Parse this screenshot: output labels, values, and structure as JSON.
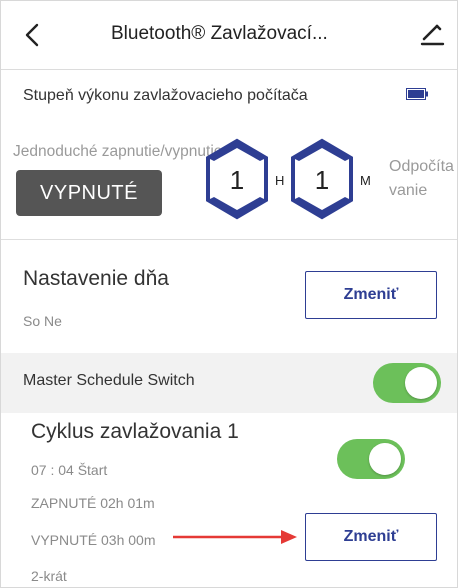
{
  "header": {
    "title": "Bluetooth® Zavlažovací...",
    "back_icon": "chevron-left-icon",
    "edit_icon": "pencil-icon"
  },
  "power": {
    "label": "Stupeň výkonu zavlažovacieho počítača",
    "battery_icon": "battery-full-icon",
    "battery_color": "#2e3e93"
  },
  "timer": {
    "simple_label": "Jednoduché zapnutie/vypnutie",
    "off_button": "VYPNUTÉ",
    "hours_value": "1",
    "hours_unit": "H",
    "minutes_value": "1",
    "minutes_unit": "M",
    "countdown_line1": "Odpočíta",
    "countdown_line2": "vanie"
  },
  "day_settings": {
    "title": "Nastavenie dňa",
    "days": "So Ne",
    "change_button": "Zmeniť"
  },
  "master": {
    "label": "Master Schedule Switch",
    "enabled": true
  },
  "cycle": {
    "title": "Cyklus zavlažovania 1",
    "start": "07 : 04  Štart",
    "on_duration": "ZAPNUTÉ 02h 01m",
    "off_duration": "VYPNUTÉ 03h 00m",
    "repeat": "2-krát",
    "enabled": true,
    "change_button": "Zmeniť"
  },
  "colors": {
    "accent": "#2e3e93",
    "toggle_on": "#6cc05a",
    "annotation_arrow": "#e53935"
  }
}
